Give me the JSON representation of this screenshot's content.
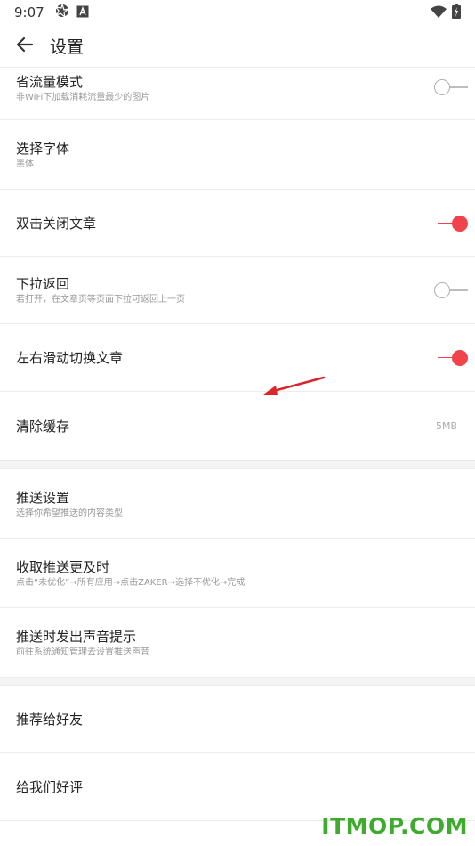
{
  "status_bar": {
    "time": "9:07",
    "icons_left": [
      "aperture-icon",
      "a-box-icon"
    ],
    "icons_right": [
      "wifi-icon",
      "battery-charging-icon"
    ]
  },
  "app_bar": {
    "back_icon": "arrow-back-icon",
    "title": "设置"
  },
  "settings": {
    "save_data": {
      "title": "省流量模式",
      "subtitle": "非WiFi下加载消耗流量最少的图片",
      "toggle_on": false
    },
    "font": {
      "title": "选择字体",
      "subtitle": "黑体"
    },
    "double_tap_close": {
      "title": "双击关闭文章",
      "toggle_on": true
    },
    "pull_back": {
      "title": "下拉返回",
      "subtitle": "若打开，在文章页等页面下拉可返回上一页",
      "toggle_on": false
    },
    "swipe_switch": {
      "title": "左右滑动切换文章",
      "toggle_on": true
    },
    "clear_cache": {
      "title": "清除缓存",
      "value": "5MB"
    }
  },
  "push": {
    "push_settings": {
      "title": "推送设置",
      "subtitle": "选择你希望推送的内容类型"
    },
    "timely_push": {
      "title": "收取推送更及时",
      "subtitle": "点击“未优化”→所有应用→点击ZAKER→选择不优化→完成"
    },
    "push_sound": {
      "title": "推送时发出声音提示",
      "subtitle": "前往系统通知管理去设置推送声音"
    }
  },
  "other": {
    "recommend": {
      "title": "推荐给好友"
    },
    "rate": {
      "title": "给我们好评"
    }
  },
  "watermark": "ITMOP.COM",
  "colors": {
    "accent": "#f0434b",
    "watermark": "#3eab2e",
    "divider": "#ececec"
  }
}
